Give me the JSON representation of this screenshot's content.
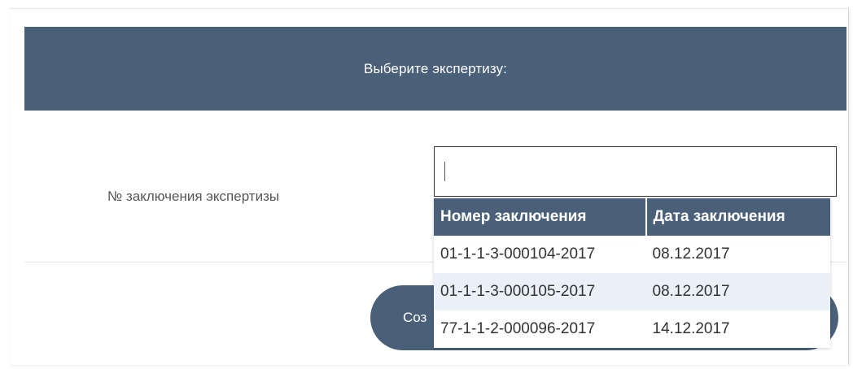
{
  "dialog": {
    "title": "Выберите экспертизу:"
  },
  "form": {
    "field_label": "№ заключения экспертизы",
    "input_value": "",
    "create_button_label": "Соз"
  },
  "dropdown": {
    "columns": [
      "Номер заключения",
      "Дата заключения"
    ],
    "rows": [
      {
        "number": "01-1-1-3-000104-2017",
        "date": "08.12.2017"
      },
      {
        "number": "01-1-1-3-000105-2017",
        "date": "08.12.2017"
      },
      {
        "number": "77-1-1-2-000096-2017",
        "date": "14.12.2017"
      }
    ],
    "highlighted_row": 1
  },
  "colors": {
    "header_bg": "#4a6078",
    "highlight_row": "#e9f0f8"
  }
}
